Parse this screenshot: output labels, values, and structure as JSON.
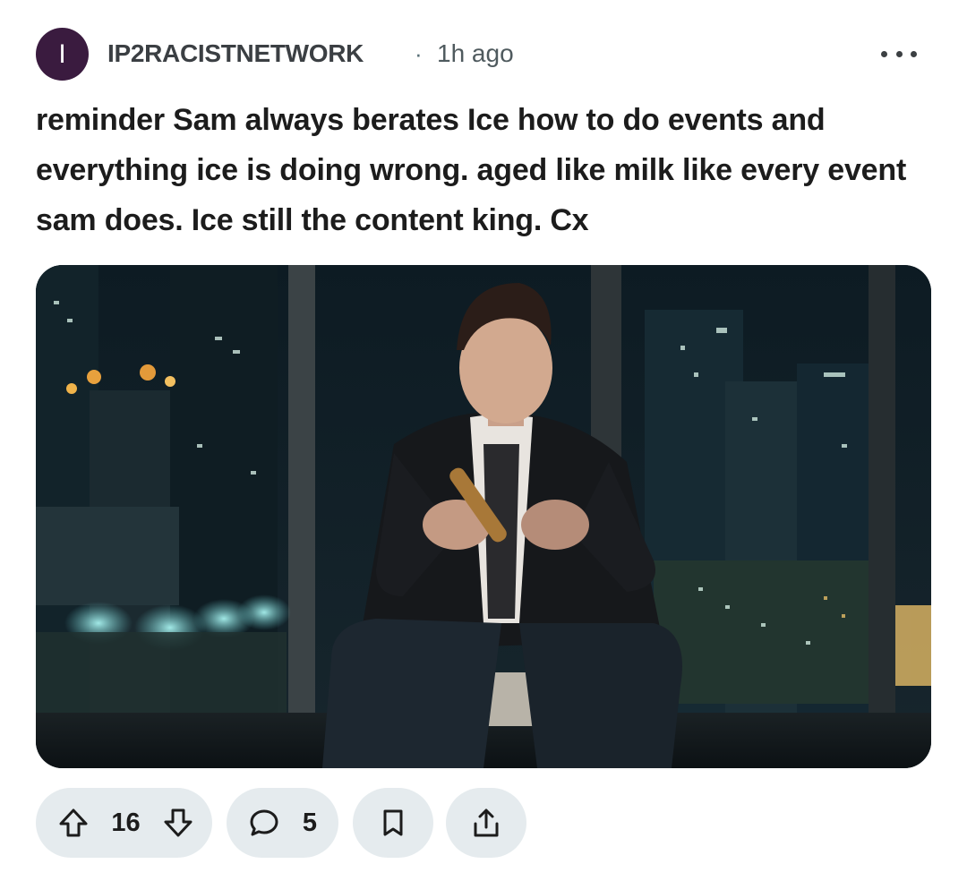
{
  "post": {
    "avatar_initial": "I",
    "author": "IP2RACISTNETWORK",
    "separator": "·",
    "time": "1h ago",
    "text": "reminder Sam always berates Ice how to do events and everything ice is doing wrong. aged like milk like every event sam does. Ice still the content king. Cx",
    "image": {
      "kind": "photo",
      "subject": "seated man holding cigar in front of night city windows"
    }
  },
  "actions": {
    "upvote_icon": "upvote-arrow-icon",
    "score": "16",
    "downvote_icon": "downvote-arrow-icon",
    "comment_icon": "comment-bubble-icon",
    "comments": "5",
    "save_icon": "bookmark-icon",
    "share_icon": "share-icon"
  },
  "colors": {
    "avatar_bg": "#3a1b3f",
    "pill_bg": "#e5ebee",
    "text": "#1c1c1c",
    "meta": "#4f5a5e"
  }
}
